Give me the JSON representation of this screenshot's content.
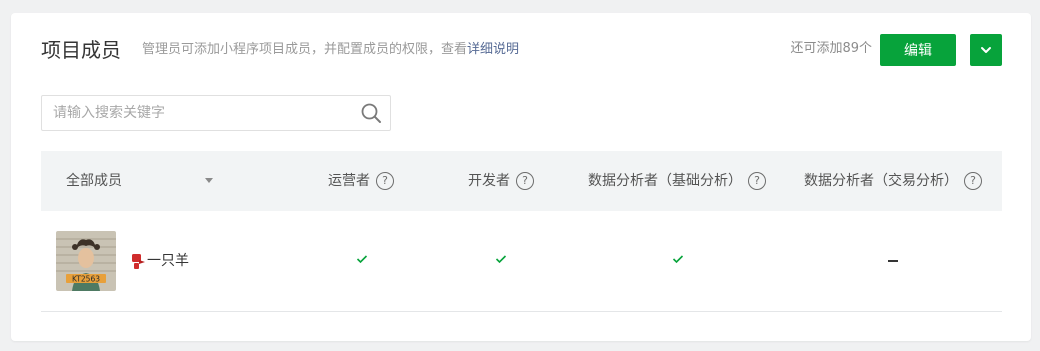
{
  "header": {
    "title": "项目成员",
    "description": "管理员可添加小程序项目成员，并配置成员的权限，查看",
    "description_link": "详细说明",
    "quota": "还可添加89个",
    "edit_button": "编辑"
  },
  "search": {
    "placeholder": "请输入搜索关键字",
    "value": ""
  },
  "table": {
    "filter_label": "全部成员",
    "columns": [
      "运营者",
      "开发者",
      "数据分析者（基础分析）",
      "数据分析者（交易分析）"
    ],
    "rows": [
      {
        "name": "一只羊",
        "avatar_caption": "KT2563",
        "permissions": [
          "check",
          "check",
          "check",
          "none"
        ]
      }
    ]
  },
  "icons": {
    "search": "search-icon",
    "dropdown": "chevron-down-icon",
    "help": "question-circle-icon",
    "check": "check-icon",
    "none": "dash-icon"
  },
  "colors": {
    "accent": "#07a33b",
    "link": "#576b95",
    "header_bg": "#f2f4f5",
    "page_bg": "#f0f1f2"
  }
}
